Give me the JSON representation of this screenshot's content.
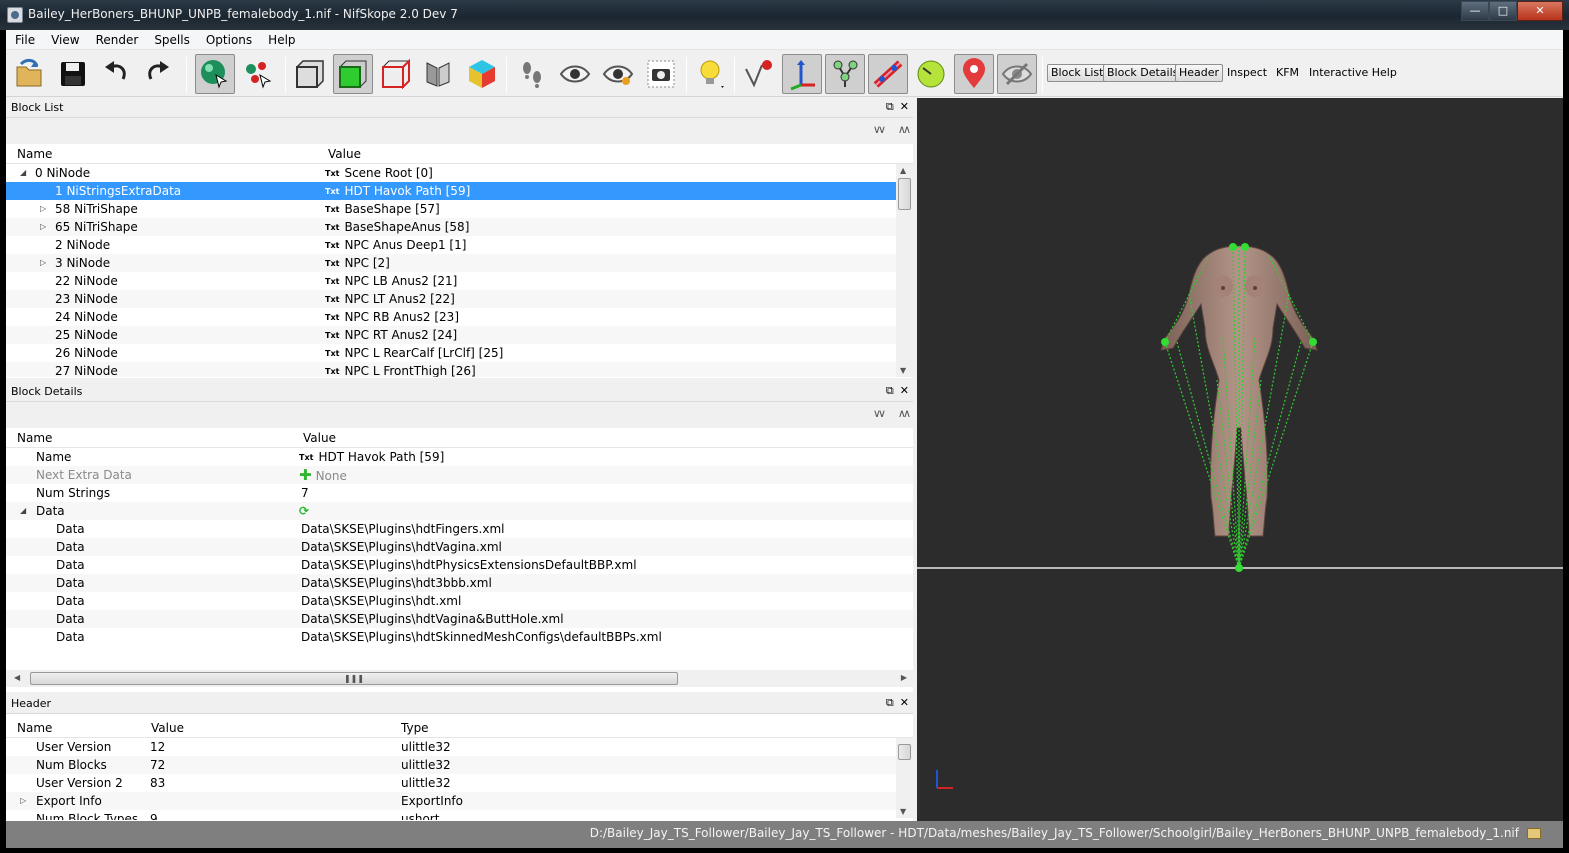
{
  "window": {
    "title": "Bailey_HerBoners_BHUNP_UNPB_femalebody_1.nif - NifSkope 2.0 Dev 7"
  },
  "menu": [
    "File",
    "View",
    "Render",
    "Spells",
    "Options",
    "Help"
  ],
  "toolbar": {
    "tabs": [
      "Block List",
      "Block Details",
      "Header"
    ],
    "links": [
      "Inspect",
      "KFM",
      "Interactive Help"
    ]
  },
  "block_list": {
    "title": "Block List",
    "col_name": "Name",
    "col_value": "Value",
    "rows": [
      {
        "name": "0 NiNode",
        "value": "Scene Root [0]"
      },
      {
        "name": "1 NiStringsExtraData",
        "value": "HDT Havok Path [59]"
      },
      {
        "name": "58 NiTriShape",
        "value": "BaseShape [57]"
      },
      {
        "name": "65 NiTriShape",
        "value": "BaseShapeAnus [58]"
      },
      {
        "name": "2 NiNode",
        "value": "NPC Anus Deep1 [1]"
      },
      {
        "name": "3 NiNode",
        "value": "NPC [2]"
      },
      {
        "name": "22 NiNode",
        "value": "NPC LB Anus2 [21]"
      },
      {
        "name": "23 NiNode",
        "value": "NPC LT Anus2 [22]"
      },
      {
        "name": "24 NiNode",
        "value": "NPC RB Anus2 [23]"
      },
      {
        "name": "25 NiNode",
        "value": "NPC RT Anus2 [24]"
      },
      {
        "name": "26 NiNode",
        "value": "NPC L RearCalf [LrClf] [25]"
      },
      {
        "name": "27 NiNode",
        "value": "NPC L FrontThigh [26]"
      }
    ]
  },
  "block_details": {
    "title": "Block Details",
    "col_name": "Name",
    "col_value": "Value",
    "rows": [
      {
        "name": "Name",
        "value": "HDT Havok Path [59]"
      },
      {
        "name": "Next Extra Data",
        "value": "None"
      },
      {
        "name": "Num Strings",
        "value": "7"
      },
      {
        "name": "Data",
        "value": ""
      },
      {
        "name": "Data",
        "value": "Data\\SKSE\\Plugins\\hdtFingers.xml"
      },
      {
        "name": "Data",
        "value": "Data\\SKSE\\Plugins\\hdtVagina.xml"
      },
      {
        "name": "Data",
        "value": "Data\\SKSE\\Plugins\\hdtPhysicsExtensionsDefaultBBP.xml"
      },
      {
        "name": "Data",
        "value": "Data\\SKSE\\Plugins\\hdt3bbb.xml"
      },
      {
        "name": "Data",
        "value": "Data\\SKSE\\Plugins\\hdt.xml"
      },
      {
        "name": "Data",
        "value": "Data\\SKSE\\Plugins\\hdtVagina&ButtHole.xml"
      },
      {
        "name": "Data",
        "value": "Data\\SKSE\\Plugins\\hdtSkinnedMeshConfigs\\defaultBBPs.xml"
      }
    ]
  },
  "header": {
    "title": "Header",
    "col_name": "Name",
    "col_value": "Value",
    "col_type": "Type",
    "rows": [
      {
        "name": "User Version",
        "value": "12",
        "type": "ulittle32"
      },
      {
        "name": "Num Blocks",
        "value": "72",
        "type": "ulittle32"
      },
      {
        "name": "User Version 2",
        "value": "83",
        "type": "ulittle32"
      },
      {
        "name": "Export Info",
        "value": "",
        "type": "ExportInfo"
      },
      {
        "name": "Num Block Types",
        "value": "9",
        "type": "ushort"
      }
    ]
  },
  "status": {
    "path": "D:/Bailey_Jay_TS_Follower/Bailey_Jay_TS_Follower - HDT/Data/meshes/Bailey_Jay_TS_Follower/Schoolgirl/Bailey_HerBoners_BHUNP_UNPB_femalebody_1.nif"
  },
  "colors": {
    "selection": "#3399ff",
    "viewport_bg": "#2c2c2c",
    "skeleton": "#33cc33",
    "status_bg": "#7f7f7f"
  }
}
